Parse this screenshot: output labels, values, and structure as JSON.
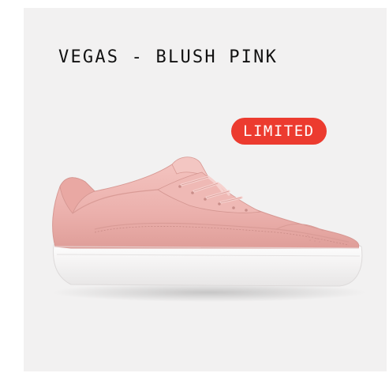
{
  "product": {
    "title": "VEGAS - BLUSH PINK",
    "badge": "LIMITED",
    "image_icon": "sneaker-image",
    "colors": {
      "background": "#f2f1f1",
      "badge": "#ec3b2f",
      "upper": "#eeb4b0",
      "sole": "#ffffff"
    }
  }
}
